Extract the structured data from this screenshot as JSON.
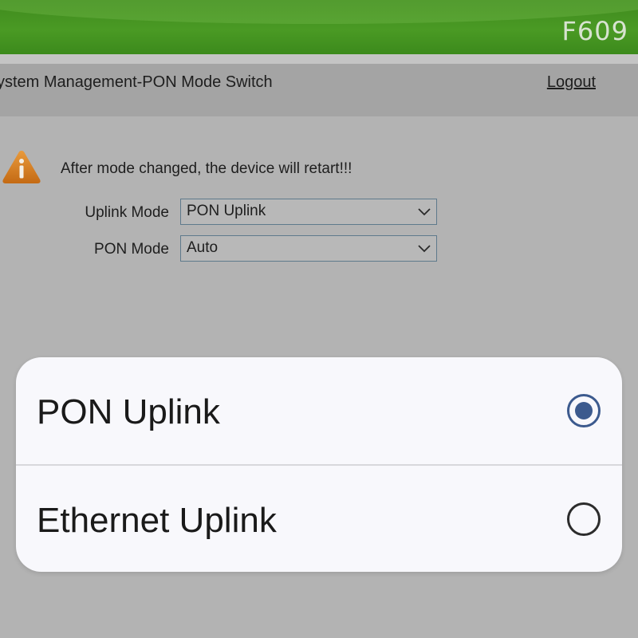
{
  "header": {
    "brand": "F609"
  },
  "title_bar": {
    "title": "ystem Management-PON Mode Switch",
    "logout": "Logout"
  },
  "content": {
    "warning_icon": "warning-icon",
    "warning_text": "After mode changed, the device will retart!!!",
    "uplink_mode": {
      "label": "Uplink Mode",
      "value": "PON Uplink"
    },
    "pon_mode": {
      "label": "PON Mode",
      "value": "Auto"
    }
  },
  "picker": {
    "options": [
      {
        "label": "PON Uplink",
        "selected": true
      },
      {
        "label": "Ethernet Uplink",
        "selected": false
      }
    ],
    "accent_color": "#3c5a8e"
  }
}
